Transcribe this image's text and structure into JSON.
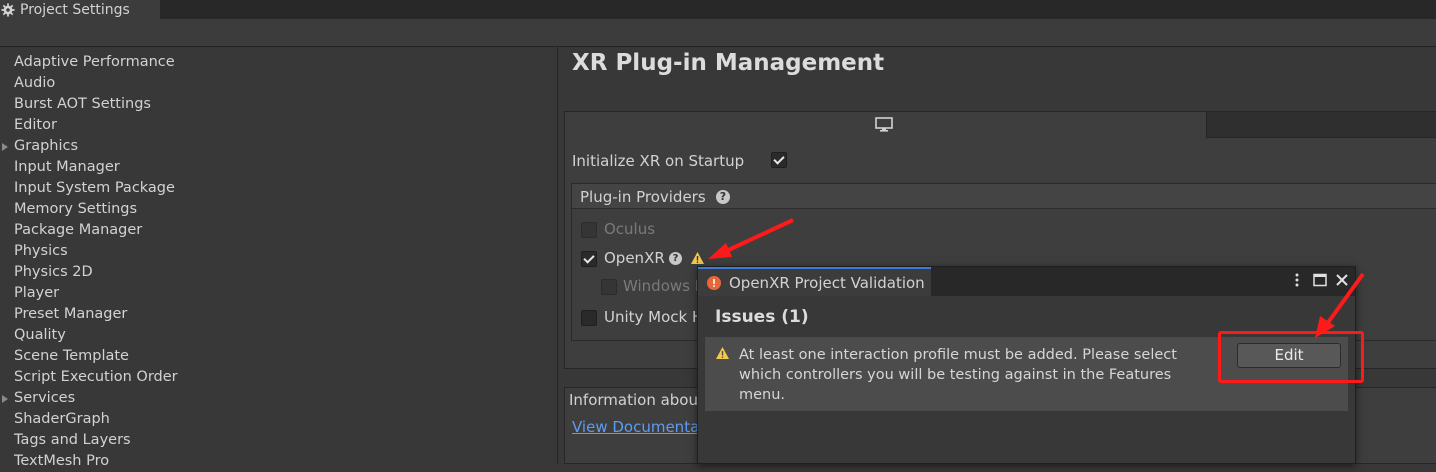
{
  "window": {
    "title": "Project Settings"
  },
  "sidebar": {
    "items": [
      {
        "label": "Adaptive Performance",
        "expandable": false
      },
      {
        "label": "Audio",
        "expandable": false
      },
      {
        "label": "Burst AOT Settings",
        "expandable": false
      },
      {
        "label": "Editor",
        "expandable": false
      },
      {
        "label": "Graphics",
        "expandable": true
      },
      {
        "label": "Input Manager",
        "expandable": false
      },
      {
        "label": "Input System Package",
        "expandable": false
      },
      {
        "label": "Memory Settings",
        "expandable": false
      },
      {
        "label": "Package Manager",
        "expandable": false
      },
      {
        "label": "Physics",
        "expandable": false
      },
      {
        "label": "Physics 2D",
        "expandable": false
      },
      {
        "label": "Player",
        "expandable": false
      },
      {
        "label": "Preset Manager",
        "expandable": false
      },
      {
        "label": "Quality",
        "expandable": false
      },
      {
        "label": "Scene Template",
        "expandable": false
      },
      {
        "label": "Script Execution Order",
        "expandable": false
      },
      {
        "label": "Services",
        "expandable": true
      },
      {
        "label": "ShaderGraph",
        "expandable": false
      },
      {
        "label": "Tags and Layers",
        "expandable": false
      },
      {
        "label": "TextMesh Pro",
        "expandable": false
      }
    ]
  },
  "main": {
    "title": "XR Plug-in Management",
    "platform_tab_icon": "monitor-icon",
    "init_xr_label": "Initialize XR on Startup",
    "init_xr_checked": true,
    "providers": {
      "header": "Plug-in Providers",
      "items": [
        {
          "label": "Oculus",
          "checked": false,
          "enabled": false
        },
        {
          "label": "OpenXR",
          "checked": true,
          "enabled": true
        },
        {
          "label": "Windows M",
          "checked": false,
          "enabled": false
        },
        {
          "label": "Unity Mock H",
          "checked": false,
          "enabled": true
        }
      ]
    },
    "info_label": "Information about",
    "docs_link": "View Documenta"
  },
  "popup": {
    "title": "OpenXR Project Validation",
    "issues_heading": "Issues (1)",
    "issue_text": "At least one interaction profile must be added.  Please select which controllers you will be testing against in the Features menu.",
    "edit_label": "Edit"
  },
  "colors": {
    "background": "#383838",
    "accent_blue": "#3b7bd6",
    "warning": "#f2c94c",
    "error": "#e8673a",
    "annotation_red": "#ff1a1a"
  }
}
